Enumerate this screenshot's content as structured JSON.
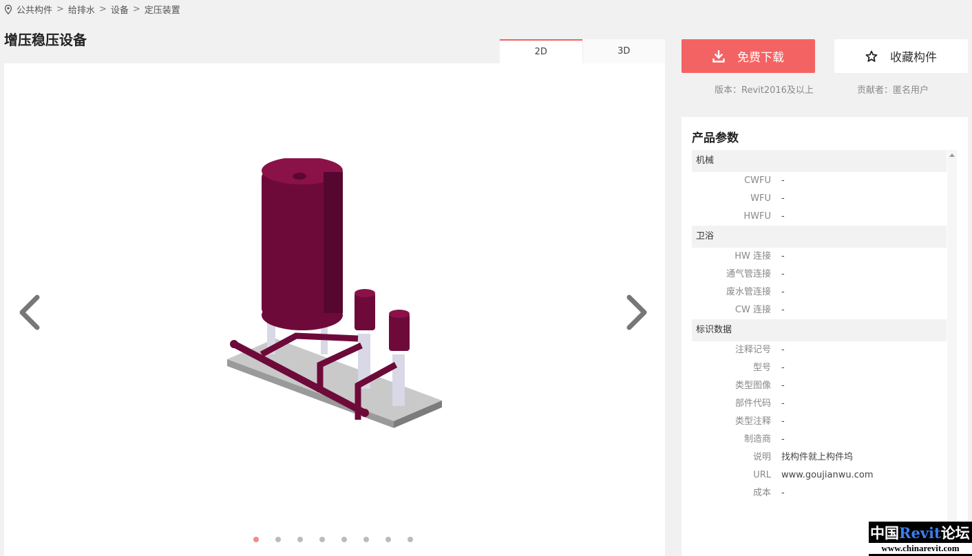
{
  "breadcrumb": {
    "items": [
      "公共构件",
      "给排水",
      "设备",
      "定压装置"
    ],
    "separator": ">"
  },
  "page_title": "增压稳压设备",
  "viewer": {
    "tabs": [
      {
        "label": "2D",
        "active": true
      },
      {
        "label": "3D",
        "active": false
      }
    ],
    "slide_count": 8,
    "active_slide": 1,
    "icons": {
      "prev": "chevron-left-icon",
      "next": "chevron-right-icon"
    }
  },
  "actions": {
    "download_label": "免费下载",
    "collect_label": "收藏构件",
    "accent_color": "#f46363"
  },
  "meta": {
    "version": "版本：Revit2016及以上",
    "contributor": "贡献者：匿名用户"
  },
  "params": {
    "title": "产品参数",
    "groups": [
      {
        "name": "机械",
        "rows": [
          {
            "key": "CWFU",
            "value": "-"
          },
          {
            "key": "WFU",
            "value": "-"
          },
          {
            "key": "HWFU",
            "value": "-"
          }
        ]
      },
      {
        "name": "卫浴",
        "rows": [
          {
            "key": "HW 连接",
            "value": "-"
          },
          {
            "key": "通气管连接",
            "value": "-"
          },
          {
            "key": "废水管连接",
            "value": "-"
          },
          {
            "key": "CW 连接",
            "value": "-"
          }
        ]
      },
      {
        "name": "标识数据",
        "rows": [
          {
            "key": "注释记号",
            "value": "-"
          },
          {
            "key": "型号",
            "value": "-"
          },
          {
            "key": "类型图像",
            "value": "-"
          },
          {
            "key": "部件代码",
            "value": "-"
          },
          {
            "key": "类型注释",
            "value": "-"
          },
          {
            "key": "制造商",
            "value": "-"
          },
          {
            "key": "说明",
            "value": "找构件就上构件坞"
          },
          {
            "key": "URL",
            "value": "www.goujianwu.com"
          },
          {
            "key": "成本",
            "value": "-"
          }
        ]
      }
    ]
  },
  "watermark": {
    "line1_a": "中国",
    "line1_b": "Revit",
    "line1_c": "论坛",
    "line2": "www.chinarevit.com"
  }
}
